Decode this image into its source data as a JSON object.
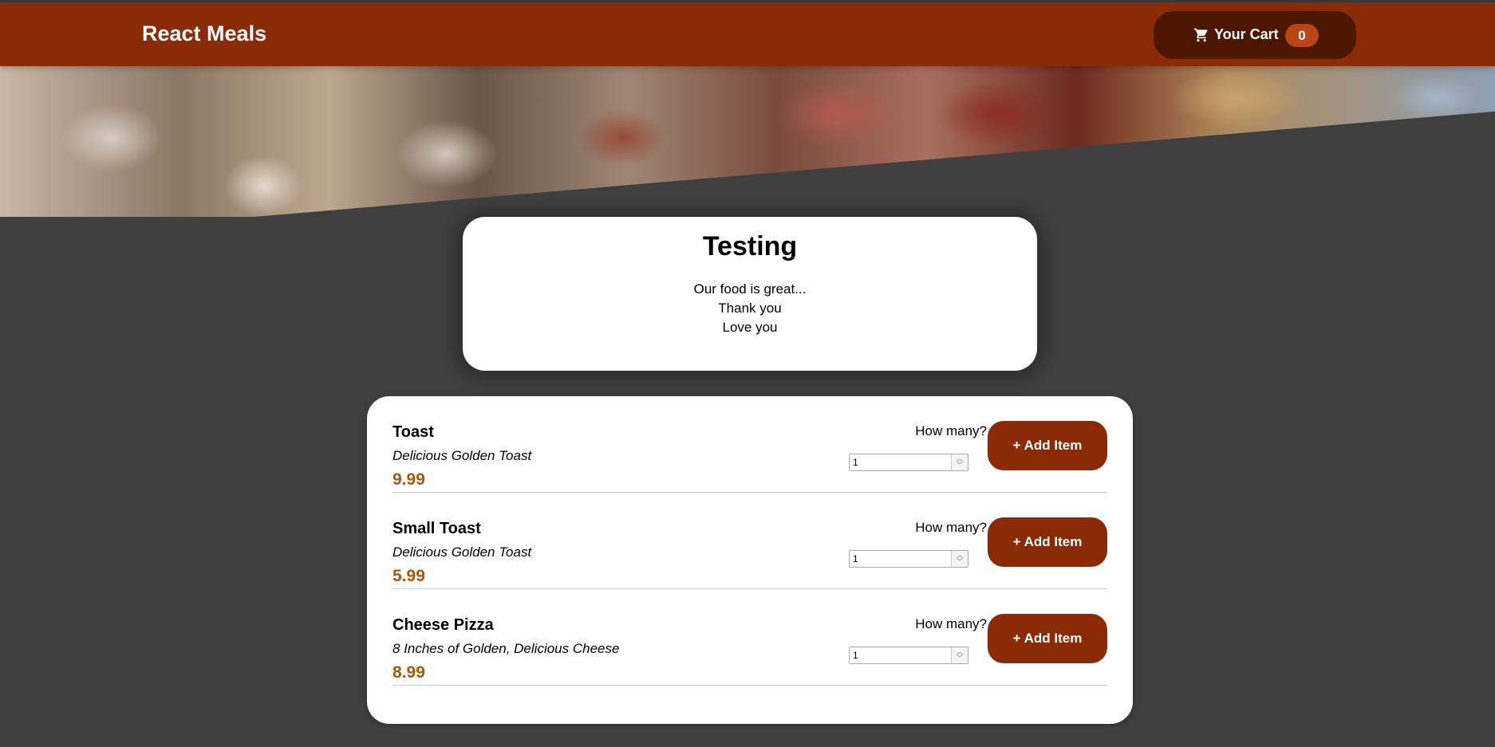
{
  "header": {
    "brand": "React Meals",
    "cart": {
      "label": "Your Cart",
      "count": "0",
      "icon": "cart-icon"
    }
  },
  "summary": {
    "title": "Testing",
    "lines": [
      "Our food is great...",
      "Thank you",
      "Love you"
    ]
  },
  "meals": [
    {
      "name": "Toast",
      "description": "Delicious Golden Toast",
      "price": "9.99",
      "amount_label": "How many?",
      "amount_value": "1",
      "add_label": "+ Add Item"
    },
    {
      "name": "Small Toast",
      "description": "Delicious Golden Toast",
      "price": "5.99",
      "amount_label": "How many?",
      "amount_value": "1",
      "add_label": "+ Add Item"
    },
    {
      "name": "Cheese Pizza",
      "description": "8 Inches of Golden, Delicious Cheese",
      "price": "8.99",
      "amount_label": "How many?",
      "amount_value": "1",
      "add_label": "+ Add Item"
    }
  ],
  "colors": {
    "header_bg": "#8a2b06",
    "cart_bg": "#4d1601",
    "badge_bg": "#b94517",
    "price": "#ad5502",
    "page_bg": "#3f3f3f"
  }
}
